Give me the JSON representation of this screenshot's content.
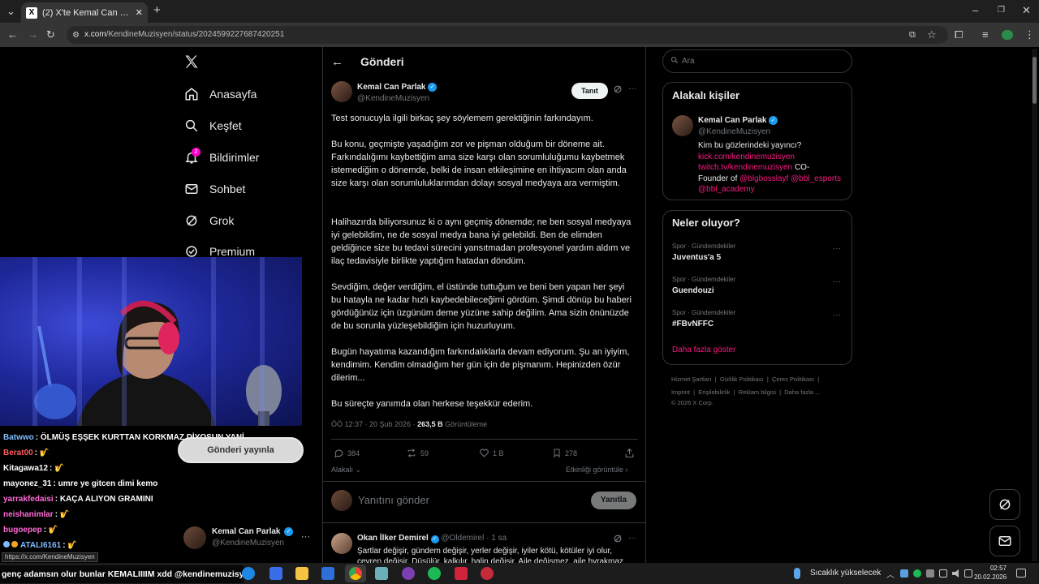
{
  "browser": {
    "tab_title": "(2) X'te Kemal Can Parlak: \"Test",
    "tab_icon": "X",
    "url_domain": "x.com",
    "url_path": "/KendineMuzisyen/status/2024599227687420251"
  },
  "nav": {
    "items": [
      {
        "label": "Anasayfa",
        "icon": "home-icon"
      },
      {
        "label": "Keşfet",
        "icon": "search-icon"
      },
      {
        "label": "Bildirimler",
        "icon": "bell-icon",
        "badge": "2"
      },
      {
        "label": "Sohbet",
        "icon": "mail-icon"
      },
      {
        "label": "Grok",
        "icon": "grok-icon"
      },
      {
        "label": "Premium",
        "icon": "premium-icon"
      }
    ],
    "post_button": "Gönderi yayınla",
    "account": {
      "name": "Kemal Can Parlak",
      "handle": "@KendineMuzisyen"
    }
  },
  "header": {
    "title": "Gönderi"
  },
  "tweet": {
    "author": "Kemal Can Parlak",
    "handle": "@KendineMuzisyen",
    "follow_label": "Tanıt",
    "paragraphs": [
      "Test sonucuyla ilgili birkaç şey söylemem gerektiğinin farkındayım.",
      "Bu konu, geçmişte yaşadığım zor ve pişman olduğum bir döneme ait. Farkındalığımı kaybettiğim ama size karşı olan sorumluluğumu kaybetmek istemediğim o dönemde, belki de insan etkileşimine en ihtiyacım olan anda size karşı olan sorumluluklarımdan dolayı sosyal medyaya ara vermiştim.",
      "Halihazırda biliyorsunuz ki o aynı geçmiş dönemde; ne ben sosyal medyaya iyi gelebildim, ne de sosyal medya bana iyi gelebildi. Ben de elimden geldiğince size bu tedavi sürecini yansıtmadan profesyonel yardım aldım ve ilaç tedavisiyle birlikte yaptığım hatadan döndüm.",
      "Sevdiğim, değer verdiğim, el üstünde tuttuğum ve beni ben yapan her şeyi bu hatayla ne kadar hızlı kaybedebileceğimi gördüm. Şimdi dönüp bu haberi gördüğünüz için üzgünüm deme yüzüne sahip değilim. Ama sizin önünüzde de bu sorunla yüzleşebildiğim için huzurluyum.",
      "Bugün hayatıma kazandığım farkındalıklarla devam ediyorum. Şu an iyiyim, kendimim. Kendim olmadığım her gün için de pişmanım. Hepinizden özür dilerim...",
      "Bu süreçte yanımda olan herkese teşekkür ederim."
    ],
    "time": "ÖÖ 12:37 · 20 Şub 2026 · ",
    "views": "263,5 B",
    "views_label": "Görüntüleme",
    "replies": "384",
    "reposts": "59",
    "likes": "1 B",
    "bookmarks": "278",
    "related_label": "Alakalı",
    "activity_label": "Etkinliği görüntüle",
    "reply_placeholder": "Yanıtını gönder",
    "reply_button": "Yanıtla"
  },
  "reply": {
    "author": "Okan İlker Demirel",
    "handle": "@Oldemirel",
    "time": "· 1 sa",
    "text": "Şartlar değişir, gündem değişir, yerler değişir, iyiler kötü, kötüler iyi olur, çevren değişir. Düşülür, kalkılır, halin değişir. Aile değişmez, aile hyrakmaz"
  },
  "right": {
    "search_placeholder": "Ara",
    "related_title": "Alakalı kişiler",
    "person": {
      "name": "Kemal Can Parlak",
      "handle": "@KendineMuzisyen",
      "bio_1": "Kim bu gözlerindeki yayıncı?",
      "link_1": "kick.com/kendinemuzisyen",
      "link_2": "twitch.tv/kendinemuzisyen",
      "co": "CO-",
      "founder": "Founder of",
      "mention_1": "@blgbosslayf",
      "mention_2": "@bbl_esports",
      "mention_3": "@bbl_academy"
    },
    "trends_title": "Neler oluyor?",
    "trends": [
      {
        "category": "Spor · Gündemdekiler",
        "name": "Juventus'a 5"
      },
      {
        "category": "Spor · Gündemdekiler",
        "name": "Guendouzi"
      },
      {
        "category": "Spor · Gündemdekiler",
        "name": "#FBvNFFC"
      }
    ],
    "show_more": "Daha fazla göster",
    "footer_1": [
      "Hizmet Şartları",
      "Gizlilik Politikası",
      "Çerez Politikası"
    ],
    "footer_2": [
      "Imprint",
      "Erişilebilirlik",
      "Reklam bilgisi",
      "Daha fazla ..."
    ],
    "copyright": "© 2026 X Corp."
  },
  "chat": [
    {
      "user": "Batwwo",
      "color": "#7dbbff",
      "msg": "ÖLMÜŞ EŞŞEK KURTTAN KORKMAZ DİYOSUN YANİ"
    },
    {
      "user": "Berat00",
      "color": "#ff5c5c",
      "msg": "🎷"
    },
    {
      "user": "Kitagawa12",
      "color": "#ffffff",
      "msg": "🎷"
    },
    {
      "user": "mayonez_31",
      "color": "#ffffff",
      "msg": "umre ye gitcen dimi kemo"
    },
    {
      "user": "yarrakfedaisi",
      "color": "#ff6bd6",
      "msg": "KAÇA ALIYON GRAMINI"
    },
    {
      "user": "neishanimlar",
      "color": "#ff6bd6",
      "msg": "🎷"
    },
    {
      "user": "bugoepep",
      "color": "#ff6bd6",
      "msg": "🎷"
    },
    {
      "user": "ATALI6161",
      "color": "#7dbbff",
      "msg": "🎷"
    }
  ],
  "status_url": "https://x.com/KendineMuzisyen",
  "ticker": "genç adamsın olur bunlar KEMALIIIIM xdd @kendinemuzisyen",
  "taskbar": {
    "weather": "Sıcaklık yükselecek",
    "time": "02:57",
    "date": "20.02.2026"
  },
  "colors": {
    "accent": "#1d9bf0",
    "pink": "#f91880",
    "verified": "#1d9bf0"
  }
}
